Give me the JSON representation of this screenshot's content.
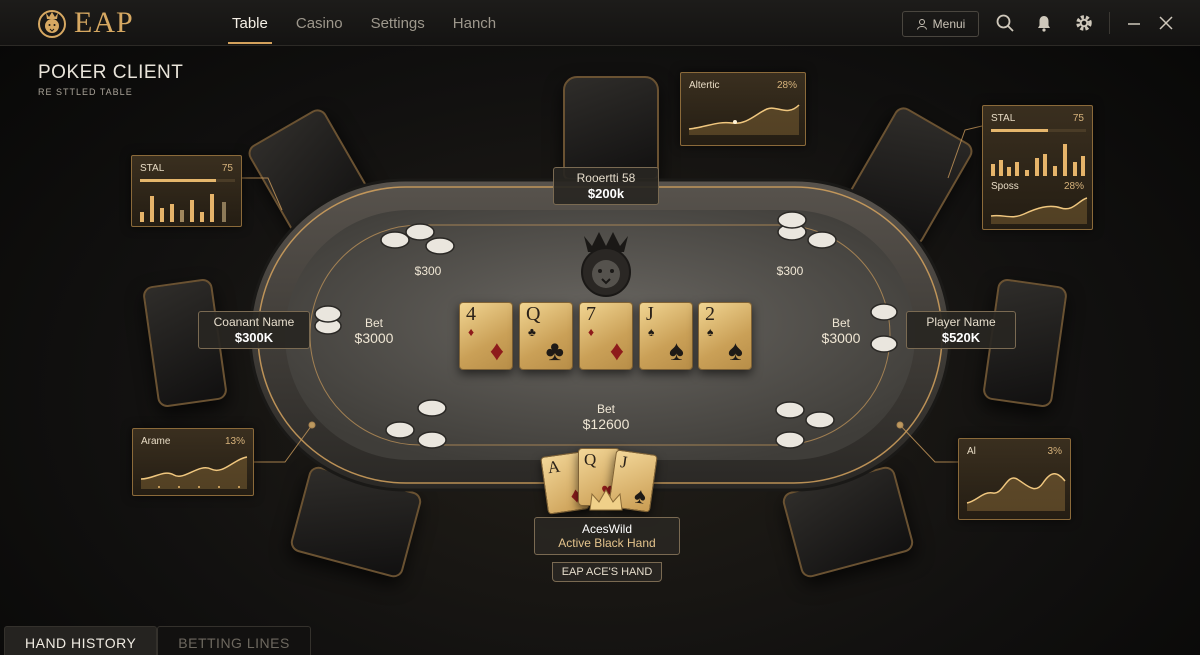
{
  "app": {
    "logo_text": "EAP"
  },
  "nav": {
    "tabs": [
      "Table",
      "Casino",
      "Settings",
      "Hanch"
    ],
    "active": "Table"
  },
  "toolbar": {
    "menu_label": "Menui"
  },
  "page": {
    "title": "POKER CLIENT",
    "subtitle": "RE STTLED TABLE"
  },
  "players": {
    "top": {
      "name": "Rooertti 58",
      "stack": "$200k"
    },
    "left": {
      "name": "Coanant Name",
      "stack": "$300K"
    },
    "right": {
      "name": "Player Name",
      "stack": "$520K"
    },
    "hero": {
      "name": "AcesWild",
      "status": "Active Black Hand",
      "tag": "EAP ACE'S HAND"
    }
  },
  "table": {
    "pot_top_left": "$300",
    "pot_top_right": "$300",
    "bet_left_label": "Bet",
    "bet_left_value": "$3000",
    "bet_right_label": "Bet",
    "bet_right_value": "$3000",
    "bet_center_label": "Bet",
    "bet_center_value": "$12600"
  },
  "community_cards": [
    {
      "rank": "4",
      "suit": "♦",
      "color": "red"
    },
    {
      "rank": "Q",
      "suit": "♣",
      "color": "black"
    },
    {
      "rank": "7",
      "suit": "♦",
      "color": "red"
    },
    {
      "rank": "J",
      "suit": "♠",
      "color": "black"
    },
    {
      "rank": "2",
      "suit": "♠",
      "color": "black"
    }
  ],
  "hero_cards": [
    {
      "rank": "A",
      "suit": "♦"
    },
    {
      "rank": "Q",
      "suit": "♥"
    },
    {
      "rank": "J",
      "suit": "♠"
    }
  ],
  "panels": {
    "top_center": {
      "label": "Altertic",
      "value": "28%"
    },
    "top_right_1": {
      "label": "STAL",
      "value": "75",
      "fill": 0.6
    },
    "top_right_2": {
      "label": "Sposs",
      "value": "28%"
    },
    "left_top": {
      "label": "STAL",
      "value": "75",
      "fill": 0.8
    },
    "left_bottom": {
      "label": "Arame",
      "value": "13%"
    },
    "right_bottom": {
      "label": "Al",
      "value": "3%"
    }
  },
  "bottom_tabs": [
    "HAND HISTORY",
    "BETTING LINES"
  ],
  "colors": {
    "accent": "#d3a15c",
    "felt": "#4a4844",
    "gold": "#c99c52"
  }
}
